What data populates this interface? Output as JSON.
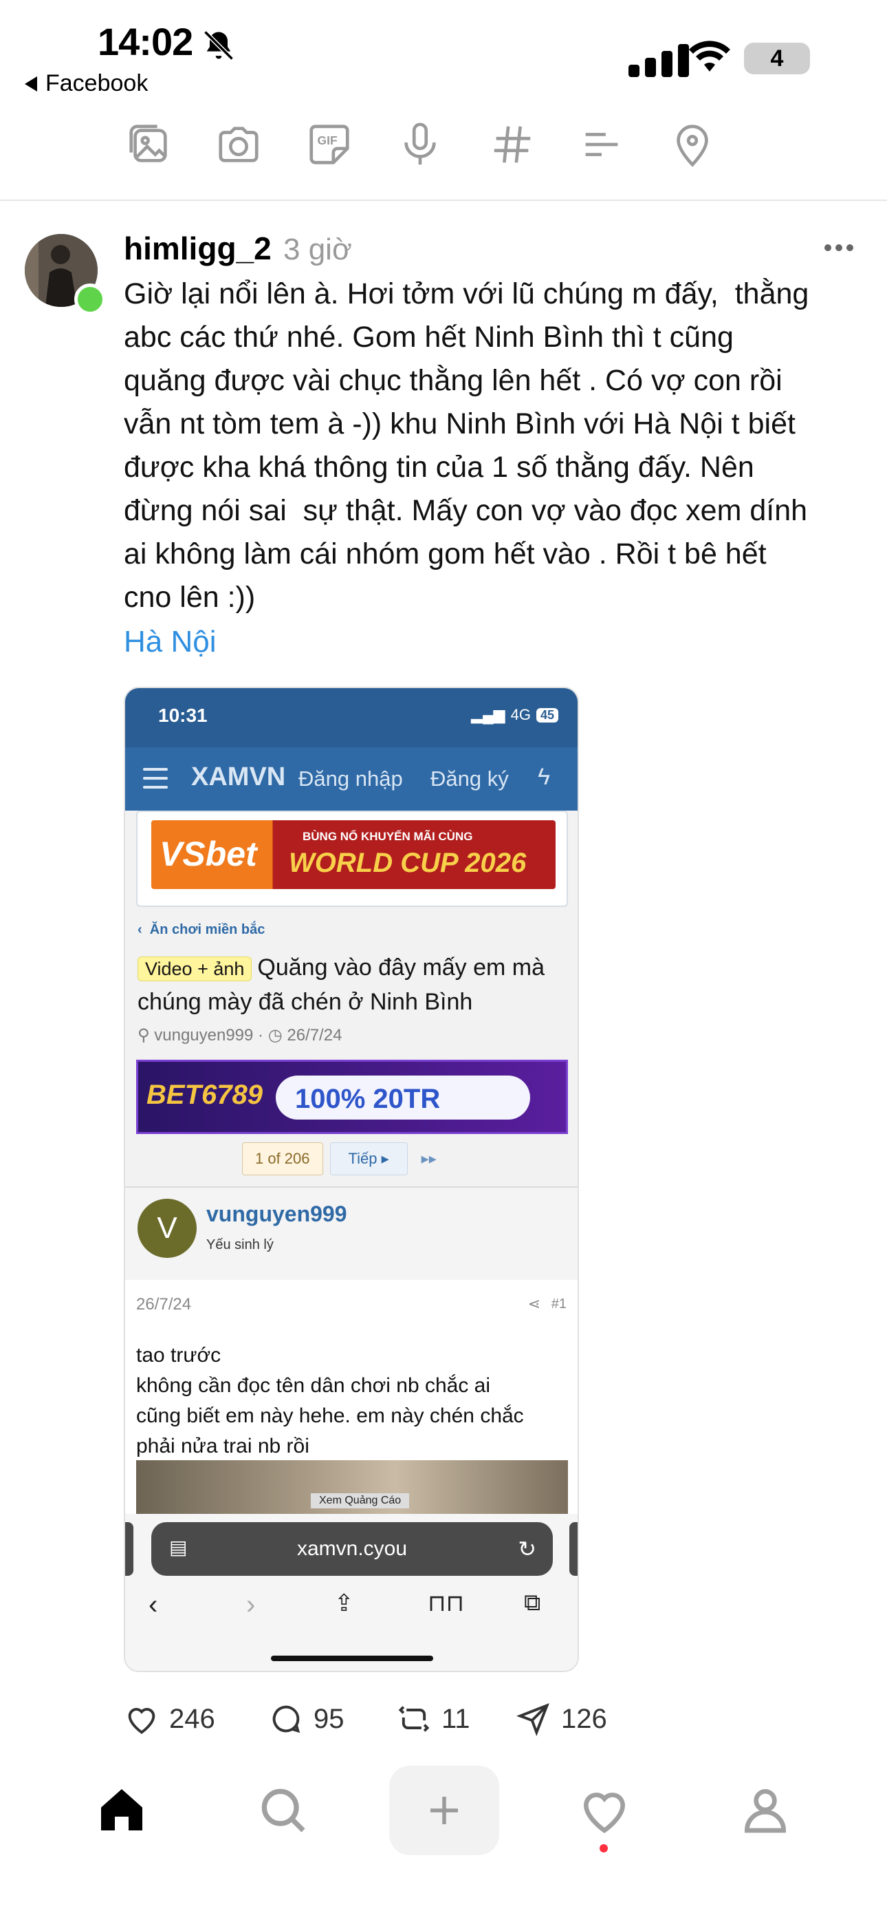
{
  "status_bar": {
    "time": "14:02",
    "battery": "4",
    "back_app": "Facebook"
  },
  "post": {
    "username": "himligg_2",
    "time_ago": "3 giờ",
    "text": "Giờ lại nổi lên à. Hơi tởm với lũ chúng m đấy,  thằng\nabc các thứ nhé. Gom hết Ninh Bình thì t cũng\nquăng được vài chục thằng lên hết . Có vợ con rồi\nvẫn nt tòm tem à -)) khu Ninh Bình với Hà Nội t biết\nđược kha khá thông tin của 1 số thằng đấy. Nên\nđừng nói sai  sự thật. Mấy con vợ vào đọc xem dính\nai không làm cái nhóm gom hết vào . Rồi t bê hết\ncno lên :))",
    "location": "Hà Nội",
    "reactions": {
      "likes": "246",
      "comments": "95",
      "reposts": "11",
      "shares": "126"
    }
  },
  "screenshot": {
    "time": "10:31",
    "network": "4G",
    "battery": "45",
    "brand": "XAMVN",
    "login": "Đăng nhập",
    "register": "Đăng ký",
    "ad1_brand": "VSbet",
    "ad1_line1": "BÙNG NỔ KHUYẾN MÃI CÙNG",
    "ad1_line2": "WORLD CUP 2026",
    "breadcrumb": "Ăn chơi miền bắc",
    "thread_tag": "Video + ảnh",
    "thread_title": "Quăng vào đây mấy em mà chúng mày đã chén ở Ninh Bình",
    "meta_user": "vunguyen999",
    "meta_date": "26/7/24",
    "ad2_brand": "BET6789",
    "ad2_offer": "100%   20TR",
    "page_indicator": "1 of 206",
    "next": "Tiếp",
    "poster_initial": "V",
    "poster_name": "vunguyen999",
    "poster_rank": "Yếu sinh lý",
    "post_date": "26/7/24",
    "post_number": "#1",
    "post_text": "tao trước\nkhông cần đọc tên dân chơi nb chắc ai\ncũng biết em này hehe. em này chén chắc\nphải nửa trai nb rồi",
    "ad_label": "Xem Quảng Cáo",
    "url": "xamvn.cyou"
  },
  "colors": {
    "location": "#2f8fe0",
    "online": "#5fd44a",
    "forum_header": "#2f6aa6"
  }
}
